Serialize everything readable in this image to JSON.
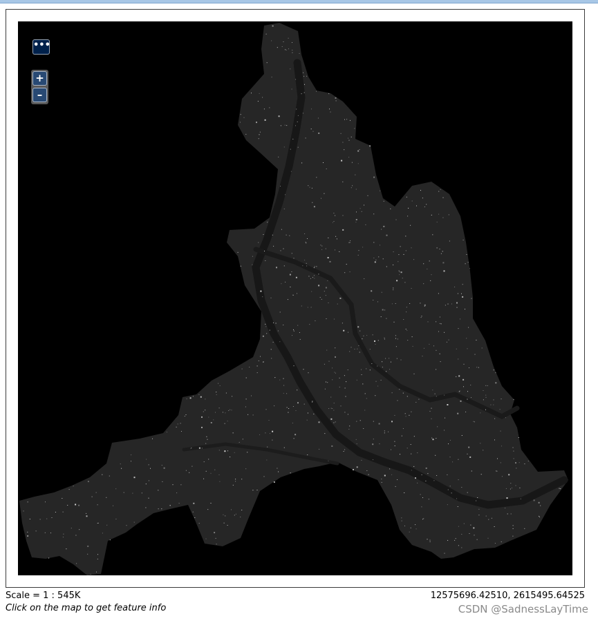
{
  "map": {
    "background_color": "#000000",
    "region_color": "#262626",
    "river_color": "#1a1a1a",
    "feature_dot_color": "#dcdcdc"
  },
  "controls": {
    "more_label": "•••",
    "zoom_in_label": "+",
    "zoom_out_label": "–"
  },
  "status": {
    "scale": "Scale = 1 : 545K",
    "coordinates": "12575696.42510, 2615495.64525",
    "hint": "Click on the map to get feature info"
  },
  "watermark": "CSDN @SadnessLayTime"
}
